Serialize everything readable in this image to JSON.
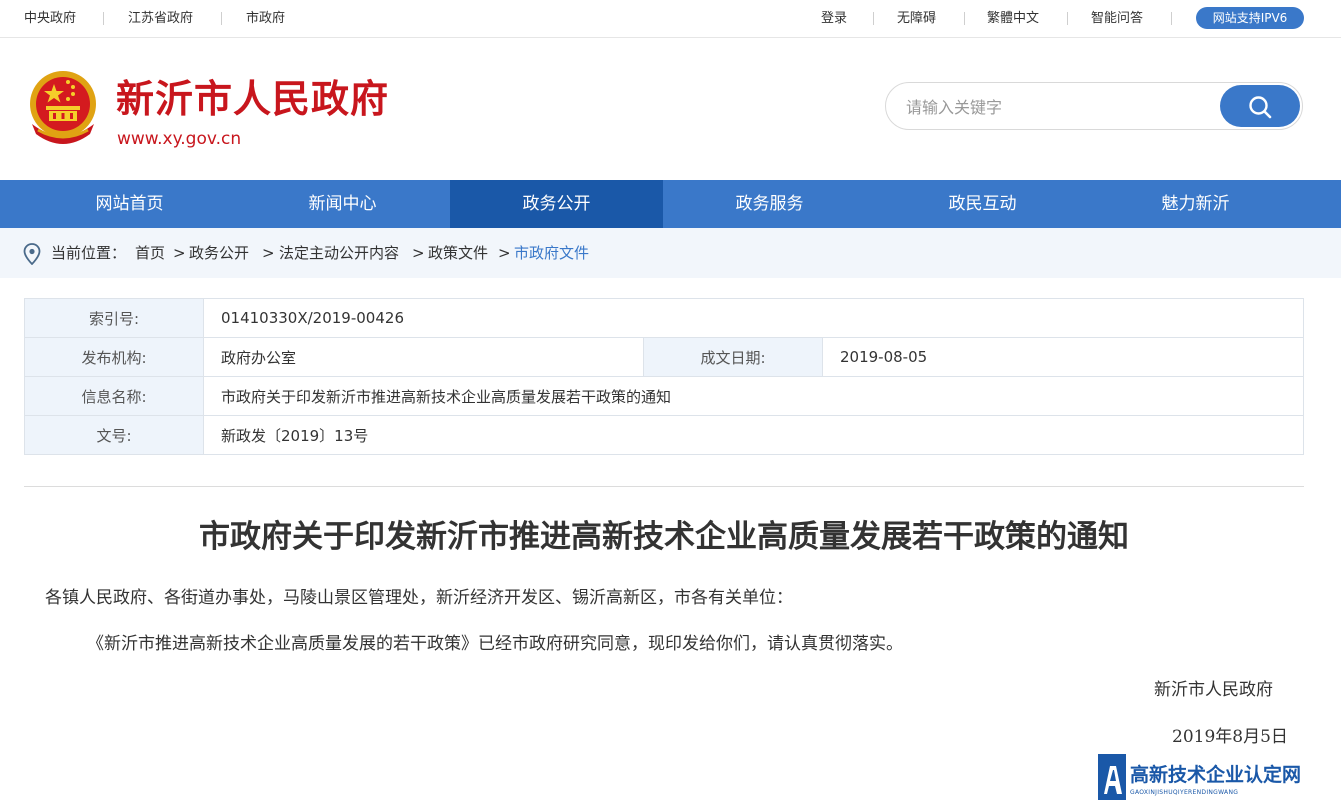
{
  "topbar": {
    "left_links": [
      "中央政府",
      "江苏省政府",
      "市政府"
    ],
    "right_links": [
      "登录",
      "无障碍",
      "繁體中文",
      "智能问答"
    ],
    "ipv6_badge": "网站支持IPV6"
  },
  "header": {
    "title": "新沂市人民政府",
    "url": "www.xy.gov.cn",
    "search_placeholder": "请输入关键字"
  },
  "colors": {
    "brand_red": "#c8161d",
    "nav_blue": "#3a78c9",
    "nav_active": "#1a58a8"
  },
  "nav": {
    "items": [
      "网站首页",
      "新闻中心",
      "政务公开",
      "政务服务",
      "政民互动",
      "魅力新沂"
    ],
    "active": "政务公开"
  },
  "breadcrumb": {
    "prefix": "当前位置：",
    "items": [
      "首页",
      "政务公开",
      "法定主动公开内容",
      "政策文件",
      "市政府文件"
    ],
    "separator": ">"
  },
  "info": {
    "index_label": "索引号:",
    "index_value": "01410330X/2019-00426",
    "org_label": "发布机构:",
    "org_value": "政府办公室",
    "date_label": "成文日期:",
    "date_value": "2019-08-05",
    "name_label": "信息名称:",
    "name_value": "市政府关于印发新沂市推进高新技术企业高质量发展若干政策的通知",
    "docno_label": "文号:",
    "docno_value": "新政发〔2019〕13号"
  },
  "document": {
    "title": "市政府关于印发新沂市推进高新技术企业高质量发展若干政策的通知",
    "salutation": "各镇人民政府、各街道办事处，马陵山景区管理处，新沂经济开发区、锡沂高新区，市各有关单位：",
    "body": "《新沂市推进高新技术企业高质量发展的若干政策》已经市政府研究同意，现印发给你们，请认真贯彻落实。",
    "signature": "新沂市人民政府",
    "date": "2019年8月5日"
  },
  "watermark": {
    "text": "高新技术企业认定网",
    "sub": "GAOXINJISHUQIYERENDINGWANG"
  }
}
